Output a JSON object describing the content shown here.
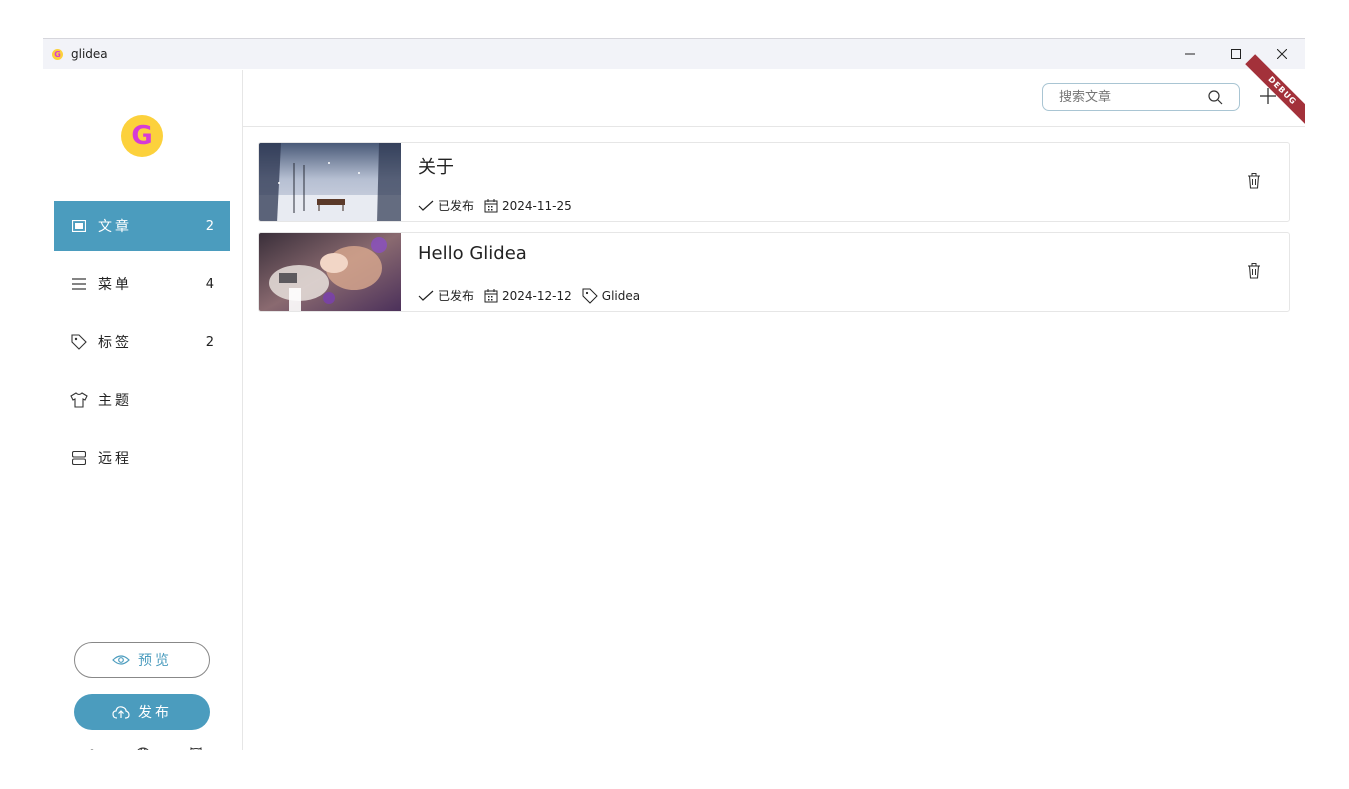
{
  "window": {
    "title": "glidea",
    "app_icon_letter": "G"
  },
  "sidebar": {
    "logo_letter": "G",
    "items": [
      {
        "label": "文章",
        "count": "2",
        "icon": "article-icon",
        "active": true
      },
      {
        "label": "菜单",
        "count": "4",
        "icon": "menu-icon",
        "active": false
      },
      {
        "label": "标签",
        "count": "2",
        "icon": "tag-icon",
        "active": false
      },
      {
        "label": "主题",
        "count": "",
        "icon": "shirt-icon",
        "active": false
      },
      {
        "label": "远程",
        "count": "",
        "icon": "server-icon",
        "active": false
      }
    ],
    "preview_label": "预览",
    "publish_label": "发布",
    "footer_icons": [
      "settings-sliders-icon",
      "globe-icon",
      "github-icon"
    ]
  },
  "toolbar": {
    "search_placeholder": "搜索文章",
    "debug_label": "DEBUG"
  },
  "posts": [
    {
      "title": "关于",
      "status": "已发布",
      "date": "2024-11-25",
      "tag": ""
    },
    {
      "title": "Hello Glidea",
      "status": "已发布",
      "date": "2024-12-12",
      "tag": "Glidea"
    }
  ],
  "colors": {
    "accent": "#4b9cbe",
    "logo_bg": "#fcd13c",
    "logo_fg": "#d63bd6",
    "debug_ribbon": "#a3313a"
  }
}
